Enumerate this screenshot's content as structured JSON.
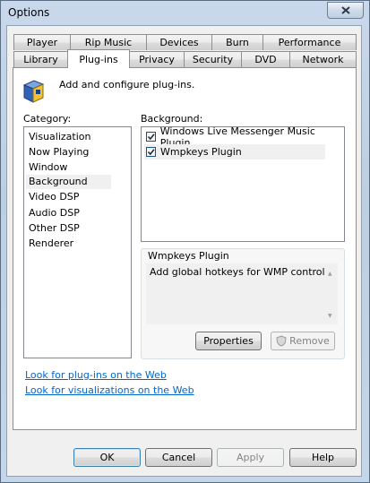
{
  "window": {
    "title": "Options",
    "close_icon": "close-icon"
  },
  "tabs": {
    "row_top": [
      "Player",
      "Rip Music",
      "Devices",
      "Burn",
      "Performance"
    ],
    "row_bottom": [
      "Library",
      "Plug-ins",
      "Privacy",
      "Security",
      "DVD",
      "Network"
    ],
    "active": "Plug-ins"
  },
  "header": {
    "icon": "plugin-icon",
    "text": "Add and configure plug-ins."
  },
  "category": {
    "label": "Category:",
    "items": [
      "Visualization",
      "Now Playing",
      "Window",
      "Background",
      "Video DSP",
      "Audio DSP",
      "Other DSP",
      "Renderer"
    ],
    "selected": "Background"
  },
  "background": {
    "label": "Background:",
    "items": [
      {
        "label": "Windows Live Messenger Music Plugin",
        "checked": true
      },
      {
        "label": "Wmpkeys Plugin",
        "checked": true
      }
    ],
    "selected": "Wmpkeys Plugin"
  },
  "details": {
    "title": "Wmpkeys Plugin",
    "description": "Add global hotkeys for WMP control",
    "properties_label": "Properties",
    "remove_label": "Remove"
  },
  "links": {
    "plugins_web": "Look for plug-ins on the Web",
    "visualizations_web": "Look for visualizations on the Web"
  },
  "footer": {
    "ok": "OK",
    "cancel": "Cancel",
    "apply": "Apply",
    "help": "Help"
  }
}
